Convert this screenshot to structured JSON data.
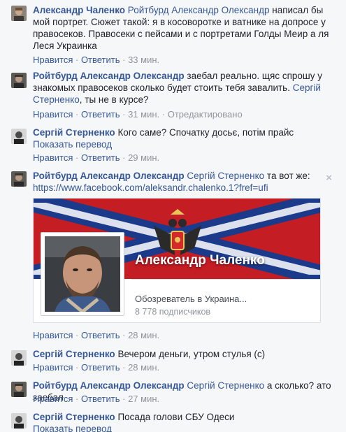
{
  "comments": [
    {
      "author": "Александр Чаленко",
      "mention": "Ройтбурд Александр Олександр",
      "text_after_mention": " написал бы мой портрет. Сюжет такой: я в косоворотке и ватнике на допросе у правосеков. Правосеки с пейсами и с портретами Голды Меир а ля Леся Украинка",
      "like": "Нравится",
      "reply": "Ответить",
      "time": "33 мин."
    },
    {
      "author": "Ройтбурд Александр Олександр",
      "text": " заебал реально. щяс спрошу у знакомых правосеков сколько будет стоить тебя завалить. ",
      "mention": "Сергій Стерненко",
      "text_after_mention": ", ты не в курсе?",
      "like": "Нравится",
      "reply": "Ответить",
      "time": "31 мин.",
      "edited": "Отредактировано"
    },
    {
      "author": "Сергій Стерненко",
      "text": " Кого саме? Спочатку досьє, потім прайс",
      "translate": "Показать перевод",
      "like": "Нравится",
      "reply": "Ответить",
      "time": "29 мин."
    },
    {
      "author": "Ройтбурд Александр Олександр",
      "mention": "Сергій Стерненко",
      "text_after_mention": " та вот же:",
      "url": "https://www.facebook.com/aleksandr.chalenko.1?fref=ufi",
      "close_icon": "×",
      "card": {
        "title": "Александр Чаленко",
        "subtitle": "Обозреватель в Украина...",
        "subscribers": "8 778 подписчиков"
      },
      "like": "Нравится",
      "reply": "Ответить",
      "time": "28 мин."
    },
    {
      "author": "Сергій Стерненко",
      "text": " Вечером деньги, утром стулья (с)",
      "like": "Нравится",
      "reply": "Ответить",
      "time": "28 мин."
    },
    {
      "author": "Ройтбурд Александр Олександр",
      "mention": "Сергій Стерненко",
      "text_after_mention": " а сколько? ато заебал",
      "like": "Нравится",
      "reply": "Ответить",
      "time": "27 мин."
    },
    {
      "author": "Сергій Стерненко",
      "text": " Посада голови СБУ Одеси",
      "translate": "Показать перевод"
    }
  ],
  "separator": " · ",
  "colors": {
    "link": "#365899",
    "meta": "#90949c",
    "bg": "#f6f7f9"
  }
}
